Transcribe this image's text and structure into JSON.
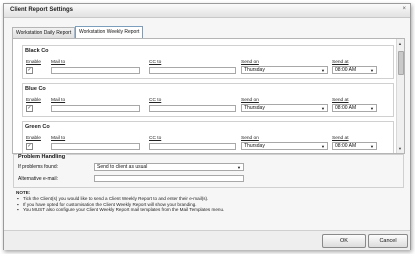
{
  "window": {
    "title": "Client Report Settings",
    "close_glyph": "×"
  },
  "tabs": [
    {
      "label": "Workstation Daily Report"
    },
    {
      "label": "Workstation Weekly Report"
    }
  ],
  "columns": {
    "enable": "Enable",
    "mail_to": "Mail to",
    "cc_to": "CC to",
    "send_on": "Send on",
    "send_at": "Send at"
  },
  "clients": [
    {
      "name": "Black Co",
      "enabled": "✓",
      "mail_to": "",
      "cc_to": "",
      "send_on": "Thursday",
      "send_at": "08:00 AM"
    },
    {
      "name": "Blue Co",
      "enabled": "✓",
      "mail_to": "",
      "cc_to": "",
      "send_on": "Thursday",
      "send_at": "08:00 AM"
    },
    {
      "name": "Green Co",
      "enabled": "✓",
      "mail_to": "",
      "cc_to": "",
      "send_on": "Thursday",
      "send_at": "08:00 AM"
    }
  ],
  "problem_handling": {
    "title": "Problem Handling",
    "if_found_label": "If problems found:",
    "if_found_value": "Send to client as usual",
    "alt_email_label": "Alternative e-mail:",
    "alt_email_value": ""
  },
  "note": {
    "heading": "NOTE:",
    "lines": [
      "Tick the Client(s) you would like to send a Client Weekly Report to and enter their e-mail(s).",
      "If you have opted for customisation the Client Weekly Report will show your branding.",
      "You MUST also configure your Client Weekly Report mail templates from the Mail Templates menu."
    ]
  },
  "buttons": {
    "ok": "OK",
    "cancel": "Cancel"
  },
  "icons": {
    "dropdown": "▼",
    "scroll_up": "▲",
    "scroll_down": "▼"
  }
}
